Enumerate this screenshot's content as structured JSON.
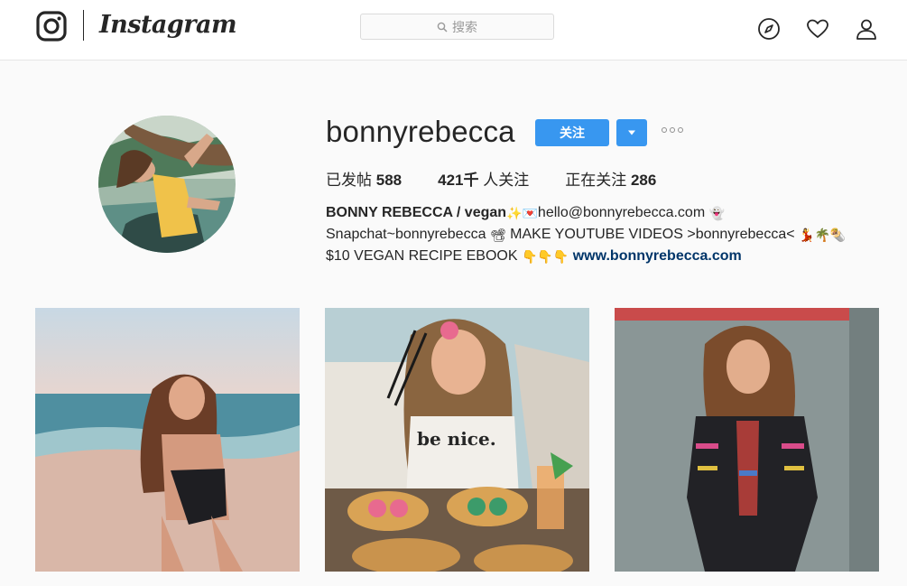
{
  "nav": {
    "wordmark": "Instagram",
    "search_placeholder": "搜索",
    "icons": [
      "instagram-glyph-icon",
      "search-icon",
      "compass-icon",
      "heart-icon",
      "user-icon"
    ]
  },
  "profile": {
    "username": "bonnyrebecca",
    "follow_label": "关注",
    "stats": {
      "posts_label": "已发帖",
      "posts_count": "588",
      "followers_count": "421千",
      "followers_label": "人关注",
      "following_label": "正在关注",
      "following_count": "286"
    },
    "bio": {
      "name": "BONNY REBECCA / vegan",
      "line1_emojis": "✨💌",
      "line1_email": "hello@bonnyrebecca.com",
      "line1_end": "👻",
      "line2_text": "Snapchat~bonnyrebecca",
      "line2_emoji_a": "📽",
      "line2_mid": "MAKE YOUTUBE VIDEOS >bonnyrebecca<",
      "line2_emojis_end": "💃🌴🌯",
      "line3_text": "$10 VEGAN RECIPE EBOOK",
      "line3_emojis": "👇👇👇",
      "website": "www.bonnyrebecca.com"
    }
  },
  "posts": [
    {
      "id": "beach",
      "shirt_text": ""
    },
    {
      "id": "dim-sum",
      "shirt_text": "be nice."
    },
    {
      "id": "embroidered-dress",
      "shirt_text": ""
    }
  ],
  "colors": {
    "accent": "#3897f0",
    "link": "#003569",
    "text": "#262626",
    "background": "#fafafa",
    "border": "#dbdbdb"
  }
}
